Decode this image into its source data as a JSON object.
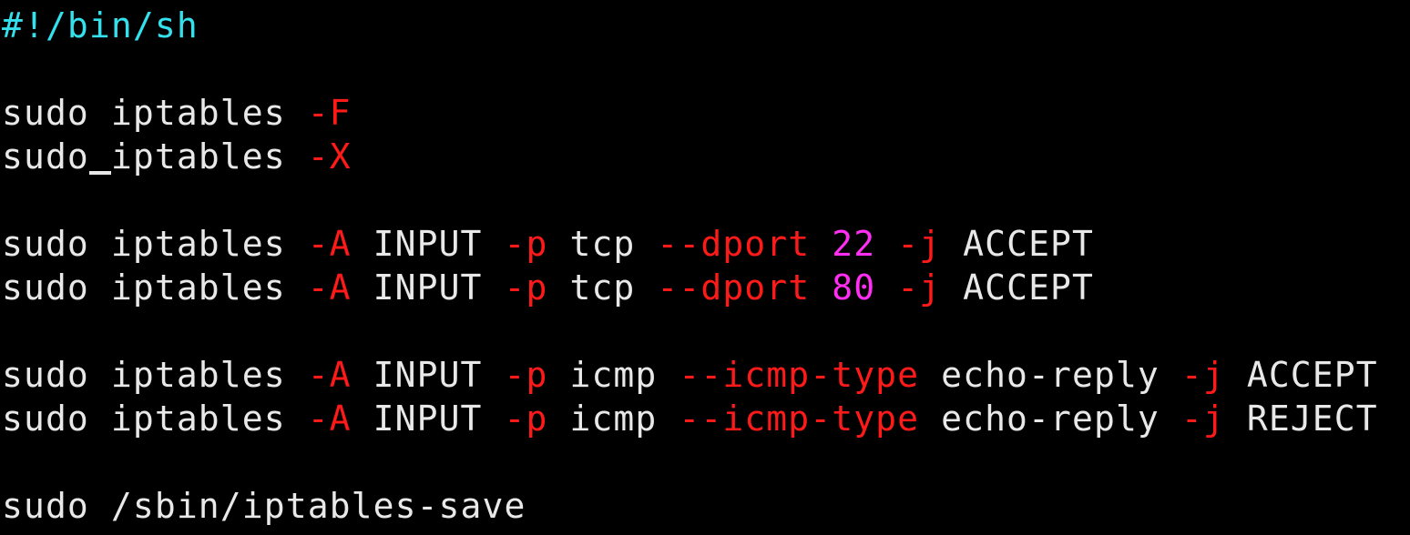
{
  "editor": {
    "lines": [
      {
        "tokens": [
          {
            "text": "#!/bin/sh",
            "kind": "shebang"
          }
        ]
      },
      {
        "tokens": [
          {
            "text": "sudo iptables ",
            "kind": "cmd"
          },
          {
            "text": "-F",
            "kind": "flag"
          }
        ]
      },
      {
        "tokens": [
          {
            "text": "sudo",
            "kind": "cmd"
          },
          {
            "text": " ",
            "kind": "cursor"
          },
          {
            "text": "iptables ",
            "kind": "cmd"
          },
          {
            "text": "-X",
            "kind": "flag"
          }
        ]
      },
      {
        "tokens": [
          {
            "text": "sudo iptables ",
            "kind": "cmd"
          },
          {
            "text": "-A",
            "kind": "flag"
          },
          {
            "text": " INPUT ",
            "kind": "cmd"
          },
          {
            "text": "-p",
            "kind": "flag"
          },
          {
            "text": " tcp ",
            "kind": "cmd"
          },
          {
            "text": "--dport",
            "kind": "flag"
          },
          {
            "text": " ",
            "kind": "cmd"
          },
          {
            "text": "22",
            "kind": "num"
          },
          {
            "text": " ",
            "kind": "cmd"
          },
          {
            "text": "-j",
            "kind": "flag"
          },
          {
            "text": " ACCEPT",
            "kind": "cmd"
          }
        ]
      },
      {
        "tokens": [
          {
            "text": "sudo iptables ",
            "kind": "cmd"
          },
          {
            "text": "-A",
            "kind": "flag"
          },
          {
            "text": " INPUT ",
            "kind": "cmd"
          },
          {
            "text": "-p",
            "kind": "flag"
          },
          {
            "text": " tcp ",
            "kind": "cmd"
          },
          {
            "text": "--dport",
            "kind": "flag"
          },
          {
            "text": " ",
            "kind": "cmd"
          },
          {
            "text": "80",
            "kind": "num"
          },
          {
            "text": " ",
            "kind": "cmd"
          },
          {
            "text": "-j",
            "kind": "flag"
          },
          {
            "text": " ACCEPT",
            "kind": "cmd"
          }
        ]
      },
      {
        "tokens": [
          {
            "text": "sudo iptables ",
            "kind": "cmd"
          },
          {
            "text": "-A",
            "kind": "flag"
          },
          {
            "text": " INPUT ",
            "kind": "cmd"
          },
          {
            "text": "-p",
            "kind": "flag"
          },
          {
            "text": " icmp ",
            "kind": "cmd"
          },
          {
            "text": "--icmp-type",
            "kind": "flag"
          },
          {
            "text": " echo-reply ",
            "kind": "cmd"
          },
          {
            "text": "-j",
            "kind": "flag"
          },
          {
            "text": " ACCEPT",
            "kind": "cmd"
          }
        ]
      },
      {
        "tokens": [
          {
            "text": "sudo iptables ",
            "kind": "cmd"
          },
          {
            "text": "-A",
            "kind": "flag"
          },
          {
            "text": " INPUT ",
            "kind": "cmd"
          },
          {
            "text": "-p",
            "kind": "flag"
          },
          {
            "text": " icmp ",
            "kind": "cmd"
          },
          {
            "text": "--icmp-type",
            "kind": "flag"
          },
          {
            "text": " echo-reply ",
            "kind": "cmd"
          },
          {
            "text": "-j",
            "kind": "flag"
          },
          {
            "text": " REJECT",
            "kind": "cmd"
          }
        ]
      },
      {
        "tokens": [
          {
            "text": "sudo /sbin/iptables-save",
            "kind": "cmd"
          }
        ]
      }
    ],
    "empty_line_marker": "~"
  },
  "colors": {
    "background": "#000000",
    "text": "#e8e8e8",
    "shebang": "#33e0ec",
    "flag": "#ff1a1a",
    "number": "#ff2ef2",
    "empty_line_marker": "#2a34ff"
  }
}
